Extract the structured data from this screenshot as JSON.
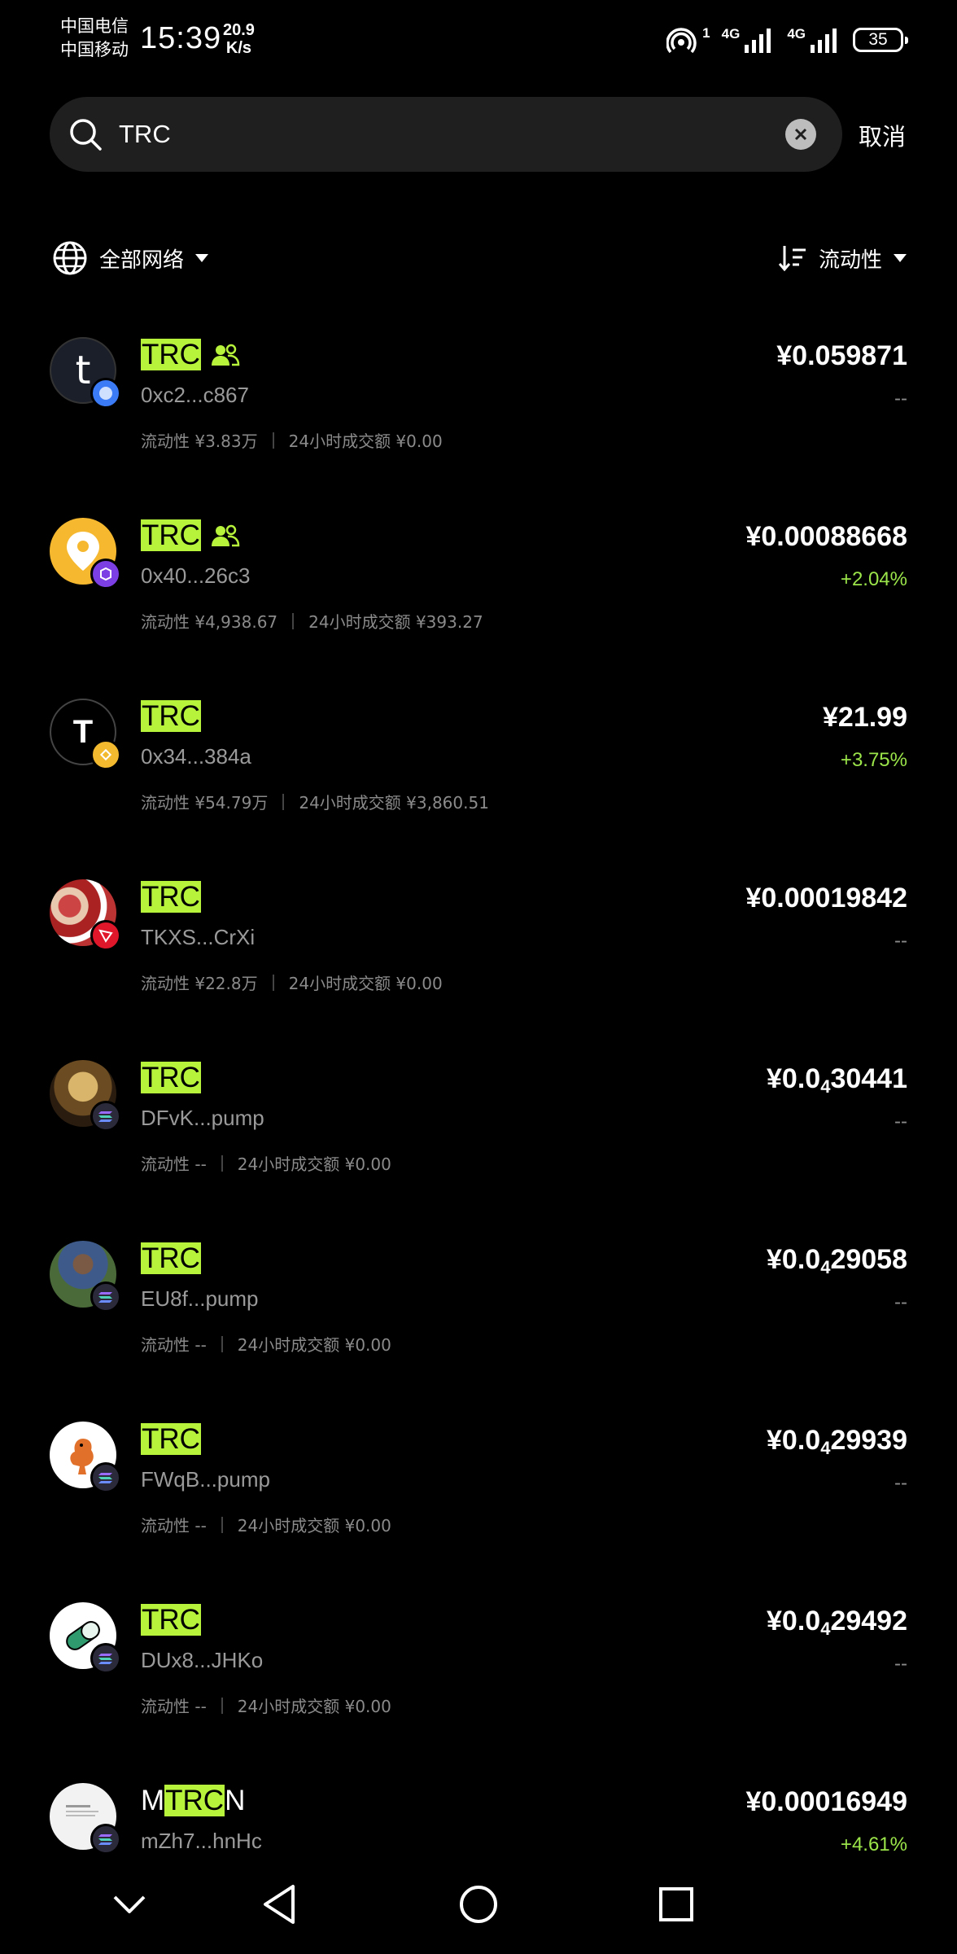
{
  "status_bar": {
    "carrier_1": "中国电信",
    "carrier_2": "中国移动",
    "time": "15:39",
    "net_speed_value": "20.9",
    "net_speed_unit": "K/s",
    "sim1_label": "4G",
    "sim2_label": "4G",
    "hotspot_label": "1",
    "battery": "35"
  },
  "search": {
    "value": "TRC",
    "cancel_label": "取消"
  },
  "filters": {
    "network_label": "全部网络",
    "sort_label": "流动性"
  },
  "tokens": [
    {
      "name_pre": "",
      "name_hl": "TRC",
      "name_post": "",
      "community": true,
      "address": "0xc2...c867",
      "liquidity": "流动性 ¥3.83万",
      "volume": "24小时成交额 ¥0.00",
      "price_main": "¥0.059871",
      "price_sub": "",
      "price_tail": "",
      "change": "--",
      "change_up": false,
      "avatar": "t-logo",
      "badge": "blue-chain-icon"
    },
    {
      "name_pre": "",
      "name_hl": "TRC",
      "name_post": "",
      "community": true,
      "address": "0x40...26c3",
      "liquidity": "流动性 ¥4,938.67",
      "volume": "24小时成交额 ¥393.27",
      "price_main": "¥0.00088668",
      "price_sub": "",
      "price_tail": "",
      "change": "+2.04%",
      "change_up": true,
      "avatar": "location-pin-logo",
      "badge": "polygon-chain-icon"
    },
    {
      "name_pre": "",
      "name_hl": "TRC",
      "name_post": "",
      "community": false,
      "address": "0x34...384a",
      "liquidity": "流动性 ¥54.79万",
      "volume": "24小时成交额 ¥3,860.51",
      "price_main": "¥21.99",
      "price_sub": "",
      "price_tail": "",
      "change": "+3.75%",
      "change_up": true,
      "avatar": "t-letter-logo",
      "badge": "bnb-chain-icon"
    },
    {
      "name_pre": "",
      "name_hl": "TRC",
      "name_post": "",
      "community": false,
      "address": "TKXS...CrXi",
      "liquidity": "流动性 ¥22.8万",
      "volume": "24小时成交额 ¥0.00",
      "price_main": "¥0.00019842",
      "price_sub": "",
      "price_tail": "",
      "change": "--",
      "change_up": false,
      "avatar": "group-photo-logo",
      "badge": "tron-chain-icon"
    },
    {
      "name_pre": "",
      "name_hl": "TRC",
      "name_post": "",
      "community": false,
      "address": "DFvK...pump",
      "liquidity": "流动性 --",
      "volume": "24小时成交额 ¥0.00",
      "price_main": "¥0.0",
      "price_sub": "4",
      "price_tail": "30441",
      "change": "--",
      "change_up": false,
      "avatar": "pharaoh-logo",
      "badge": "solana-chain-icon"
    },
    {
      "name_pre": "",
      "name_hl": "TRC",
      "name_post": "",
      "community": false,
      "address": "EU8f...pump",
      "liquidity": "流动性 --",
      "volume": "24小时成交额 ¥0.00",
      "price_main": "¥0.0",
      "price_sub": "4",
      "price_tail": "29058",
      "change": "--",
      "change_up": false,
      "avatar": "person-photo-logo",
      "badge": "solana-chain-icon"
    },
    {
      "name_pre": "",
      "name_hl": "TRC",
      "name_post": "",
      "community": false,
      "address": "FWqB...pump",
      "liquidity": "流动性 --",
      "volume": "24小时成交额 ¥0.00",
      "price_main": "¥0.0",
      "price_sub": "4",
      "price_tail": "29939",
      "change": "--",
      "change_up": false,
      "avatar": "rooster-logo",
      "badge": "solana-chain-icon"
    },
    {
      "name_pre": "",
      "name_hl": "TRC",
      "name_post": "",
      "community": false,
      "address": "DUx8...JHKo",
      "liquidity": "流动性 --",
      "volume": "24小时成交额 ¥0.00",
      "price_main": "¥0.0",
      "price_sub": "4",
      "price_tail": "29492",
      "change": "--",
      "change_up": false,
      "avatar": "pill-logo",
      "badge": "solana-chain-icon"
    },
    {
      "name_pre": "M",
      "name_hl": "TRC",
      "name_post": "N",
      "community": false,
      "address": "mZh7...hnHc",
      "liquidity": "",
      "volume": "",
      "price_main": "¥0.00016949",
      "price_sub": "",
      "price_tail": "",
      "change": "+4.61%",
      "change_up": true,
      "avatar": "document-logo",
      "badge": "solana-chain-icon"
    }
  ],
  "colors": {
    "highlight": "#b7f33b",
    "positive": "#9be54a",
    "muted": "#8a8a8a",
    "background": "#000000",
    "search_bg": "#1f1f1f"
  }
}
